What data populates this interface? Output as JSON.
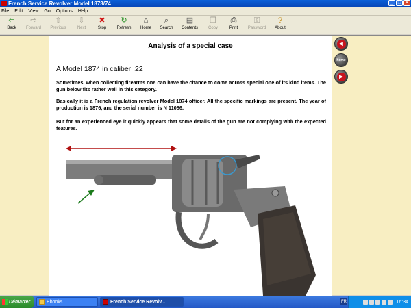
{
  "window": {
    "title": "French Service Revolver Model 1873/74"
  },
  "menu": [
    "File",
    "Edit",
    "View",
    "Go",
    "Options",
    "Help"
  ],
  "toolbar": [
    {
      "label": "Back",
      "icon": "back-arrow-icon",
      "glyph": "⇦",
      "color": "#1a8a1a",
      "disabled": false
    },
    {
      "label": "Forward",
      "icon": "forward-arrow-icon",
      "glyph": "⇨",
      "color": "#9a978c",
      "disabled": true
    },
    {
      "label": "Previous",
      "icon": "up-arrow-icon",
      "glyph": "⇧",
      "color": "#9a978c",
      "disabled": true
    },
    {
      "label": "Next",
      "icon": "down-arrow-icon",
      "glyph": "⇩",
      "color": "#9a978c",
      "disabled": true
    },
    {
      "label": "Stop",
      "icon": "stop-icon",
      "glyph": "✖",
      "color": "#d01010",
      "disabled": false
    },
    {
      "label": "Refresh",
      "icon": "refresh-icon",
      "glyph": "↻",
      "color": "#1a8a1a",
      "disabled": false
    },
    {
      "label": "Home",
      "icon": "home-icon",
      "glyph": "⌂",
      "color": "#333333",
      "disabled": false
    },
    {
      "label": "Search",
      "icon": "search-icon",
      "glyph": "⌕",
      "color": "#333333",
      "disabled": false
    },
    {
      "label": "Contents",
      "icon": "contents-icon",
      "glyph": "▤",
      "color": "#555555",
      "disabled": false
    },
    {
      "label": "Copy",
      "icon": "copy-icon",
      "glyph": "❐",
      "color": "#9a978c",
      "disabled": true
    },
    {
      "label": "Print",
      "icon": "print-icon",
      "glyph": "⎙",
      "color": "#333333",
      "disabled": false
    },
    {
      "label": "Password",
      "icon": "password-icon",
      "glyph": "⚿",
      "color": "#9a978c",
      "disabled": true
    },
    {
      "label": "About",
      "icon": "about-icon",
      "glyph": "?",
      "color": "#c08000",
      "disabled": false
    }
  ],
  "page": {
    "heading": "Analysis of a special case",
    "subheading": "A Model 1874 in caliber .22",
    "paragraphs": [
      "Sometimes, when collecting firearms one can have the chance to come across special one of its kind items. The gun below fits rather well in this category.",
      "Basically it is a French regulation revolver Model 1874 officer. All the specific markings are present. The year of production is 1876, and the serial number is N 11086.",
      "But for an experienced eye it quickly appears that some details of the gun are not complying with the expected features."
    ]
  },
  "nav": {
    "back_icon": "left-arrow-icon",
    "home_label": "home",
    "forward_icon": "right-arrow-icon"
  },
  "taskbar": {
    "start_label": "Démarrer",
    "tasks": [
      {
        "label": "Ebooks",
        "active": false
      },
      {
        "label": "French Service Revolv...",
        "active": true
      }
    ],
    "lang": "FR",
    "clock": "16:34"
  },
  "colors": {
    "page_background": "#f8eec2",
    "nav_button_red": "#c8141e",
    "annotation_arrow_red": "#b01010",
    "annotation_arrow_green": "#1a7a1a",
    "annotation_circle": "#3a9ad0"
  }
}
